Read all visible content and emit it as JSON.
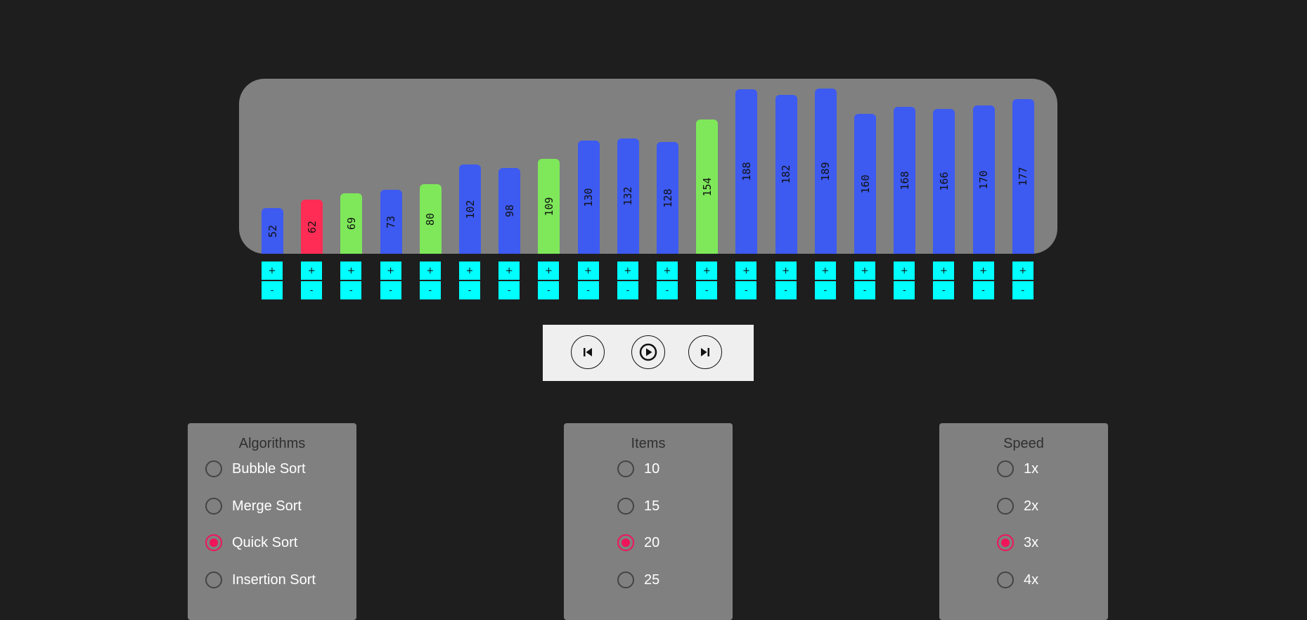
{
  "colors": {
    "background": "#1e1e1e",
    "chart_bg": "#808080",
    "default": "#3d5af1",
    "pivot": "#ff2d55",
    "sorted": "#7ee85a",
    "stepper": "#00ffff",
    "accent": "#f0145a"
  },
  "chart_data": {
    "type": "bar",
    "values": [
      52,
      62,
      69,
      73,
      80,
      102,
      98,
      109,
      130,
      132,
      128,
      154,
      188,
      182,
      189,
      160,
      168,
      166,
      170,
      177
    ],
    "states": [
      "default",
      "pivot",
      "sorted",
      "default",
      "sorted",
      "default",
      "default",
      "sorted",
      "default",
      "default",
      "default",
      "sorted",
      "default",
      "default",
      "default",
      "default",
      "default",
      "default",
      "default",
      "default"
    ],
    "ylim": [
      0,
      190
    ]
  },
  "stepper": {
    "plus": "+",
    "minus": "-"
  },
  "controls": [
    {
      "icon": "skip-back-icon",
      "name": "previous-step-button"
    },
    {
      "icon": "play-icon",
      "name": "play-button"
    },
    {
      "icon": "skip-forward-icon",
      "name": "next-step-button"
    }
  ],
  "panels": {
    "algorithms": {
      "title": "Algorithms",
      "options": [
        "Bubble Sort",
        "Merge Sort",
        "Quick Sort",
        "Insertion Sort"
      ],
      "selected": 2
    },
    "items": {
      "title": "Items",
      "options": [
        "10",
        "15",
        "20",
        "25"
      ],
      "selected": 2
    },
    "speed": {
      "title": "Speed",
      "options": [
        "1x",
        "2x",
        "3x",
        "4x"
      ],
      "selected": 2
    }
  }
}
